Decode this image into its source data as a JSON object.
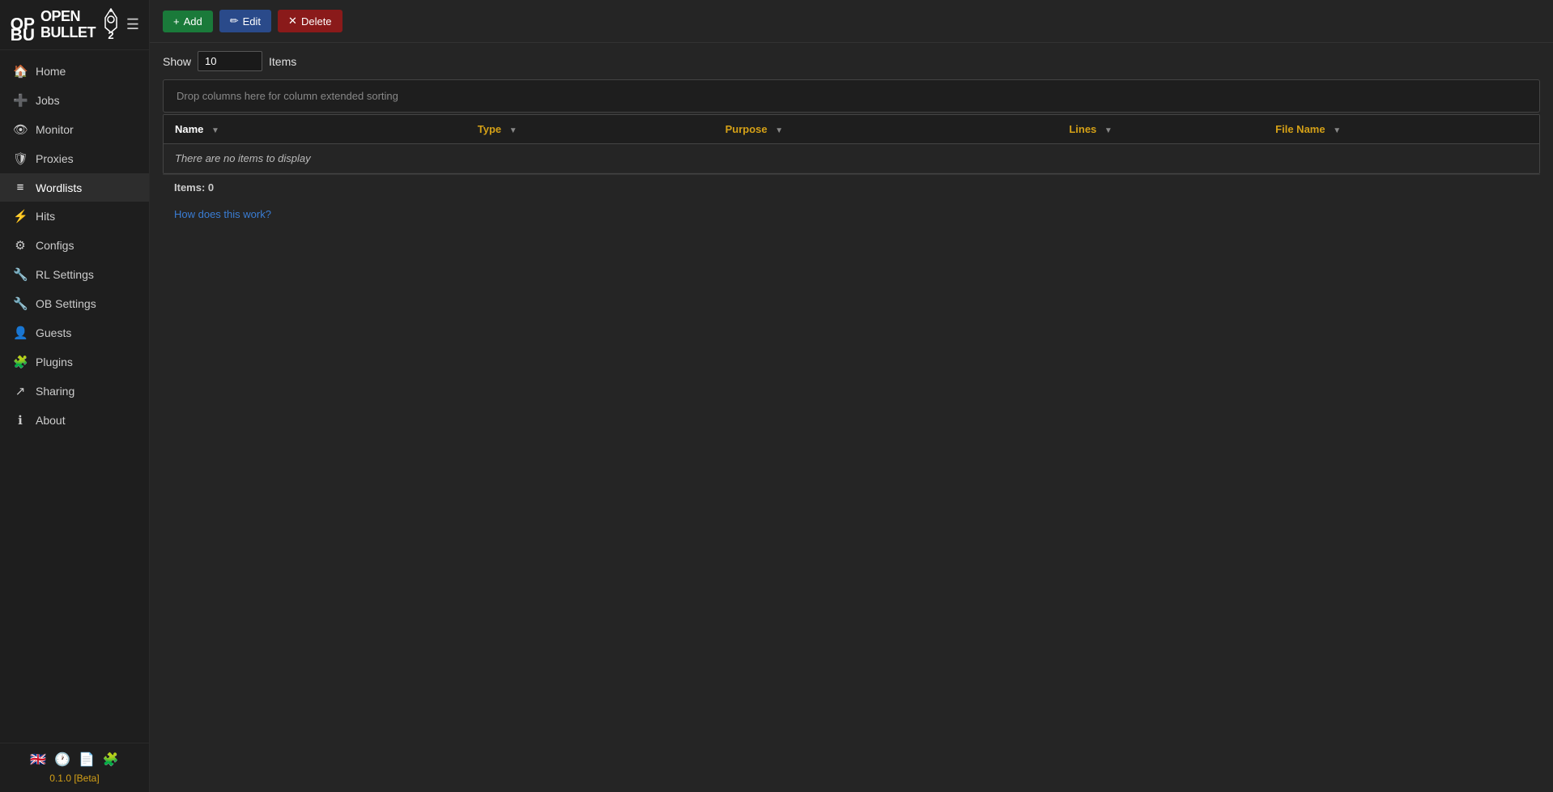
{
  "app": {
    "title": "OpenBullet 2",
    "version": "0.1.0 [Beta]",
    "superscript": "2"
  },
  "sidebar": {
    "hamburger_icon": "☰",
    "items": [
      {
        "id": "home",
        "label": "Home",
        "icon": "🏠",
        "active": false
      },
      {
        "id": "jobs",
        "label": "Jobs",
        "icon": "✚",
        "active": false
      },
      {
        "id": "monitor",
        "label": "Monitor",
        "icon": "👁",
        "active": false
      },
      {
        "id": "proxies",
        "label": "Proxies",
        "icon": "🛡",
        "active": false
      },
      {
        "id": "wordlists",
        "label": "Wordlists",
        "icon": "≡",
        "active": true
      },
      {
        "id": "hits",
        "label": "Hits",
        "icon": "⚡",
        "active": false
      },
      {
        "id": "configs",
        "label": "Configs",
        "icon": "⚙",
        "active": false
      },
      {
        "id": "rl-settings",
        "label": "RL Settings",
        "icon": "🔧",
        "active": false
      },
      {
        "id": "ob-settings",
        "label": "OB Settings",
        "icon": "🔧",
        "active": false
      },
      {
        "id": "guests",
        "label": "Guests",
        "icon": "👤",
        "active": false
      },
      {
        "id": "plugins",
        "label": "Plugins",
        "icon": "🧩",
        "active": false
      },
      {
        "id": "sharing",
        "label": "Sharing",
        "icon": "↗",
        "active": false
      },
      {
        "id": "about",
        "label": "About",
        "icon": "ℹ",
        "active": false
      }
    ],
    "footer": {
      "flag_icon": "🇬🇧",
      "clock_icon": "🕐",
      "file_icon": "📄",
      "puzzle_icon": "🧩"
    }
  },
  "toolbar": {
    "add_label": "Add",
    "edit_label": "Edit",
    "delete_label": "Delete",
    "add_icon": "+",
    "edit_icon": "✏",
    "delete_icon": "✕"
  },
  "show_row": {
    "show_label": "Show",
    "items_label": "Items",
    "value": "10"
  },
  "table": {
    "drop_zone_text": "Drop columns here for column extended sorting",
    "columns": [
      {
        "id": "name",
        "label": "Name"
      },
      {
        "id": "type",
        "label": "Type"
      },
      {
        "id": "purpose",
        "label": "Purpose"
      },
      {
        "id": "lines",
        "label": "Lines"
      },
      {
        "id": "filename",
        "label": "File Name"
      }
    ],
    "no_items_text": "There are no items to display",
    "items_count_label": "Items:",
    "items_count_value": "0"
  },
  "how_link": {
    "text": "How does this work?"
  }
}
